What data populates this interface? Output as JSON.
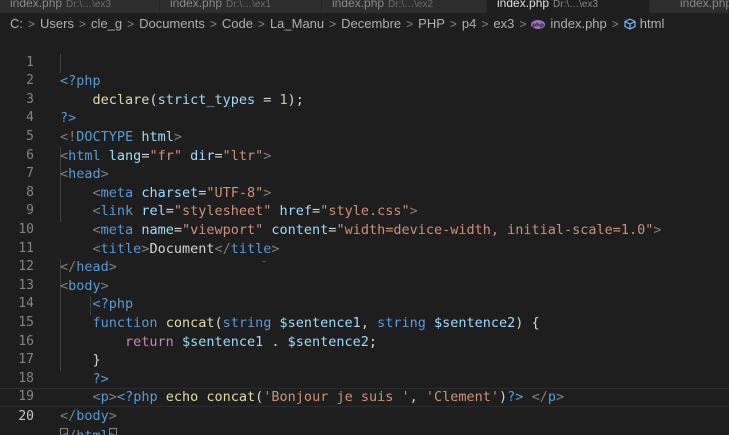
{
  "tabs": [
    {
      "file": "index.php",
      "path": "Dr:\\…\\ex3"
    },
    {
      "file": "index.php",
      "path": "Dr:\\…\\ex1"
    },
    {
      "file": "index.php",
      "path": "Dr:\\…\\ex2"
    },
    {
      "file": "index.php",
      "path": "Dr:\\…\\ex3"
    },
    {
      "file": "index.php",
      "path": ""
    }
  ],
  "breadcrumb": {
    "segments": [
      "C:",
      "Users",
      "cle_g",
      "Documents",
      "Code",
      "La_Manu",
      "Decembre",
      "PHP",
      "p4",
      "ex3"
    ],
    "file": "index.php",
    "symbol": "html",
    "separator": ">",
    "file_icon_color": "#a074c4",
    "symbol_icon_color": "#75beff"
  },
  "editor": {
    "current_line": 20,
    "line_numbers": [
      "1",
      "2",
      "3",
      "4",
      "5",
      "6",
      "7",
      "8",
      "9",
      "10",
      "11",
      "12",
      "13",
      "14",
      "15",
      "16",
      "17",
      "18",
      "19",
      "20"
    ],
    "cursor_glyph": "⁻"
  },
  "theme": {
    "background": "#1e1e1e",
    "keyword": "#569cd6",
    "function": "#dcdcaa",
    "attribute": "#9cdcfe",
    "string": "#ce9178",
    "number": "#b5cea8",
    "control": "#c586c0"
  }
}
